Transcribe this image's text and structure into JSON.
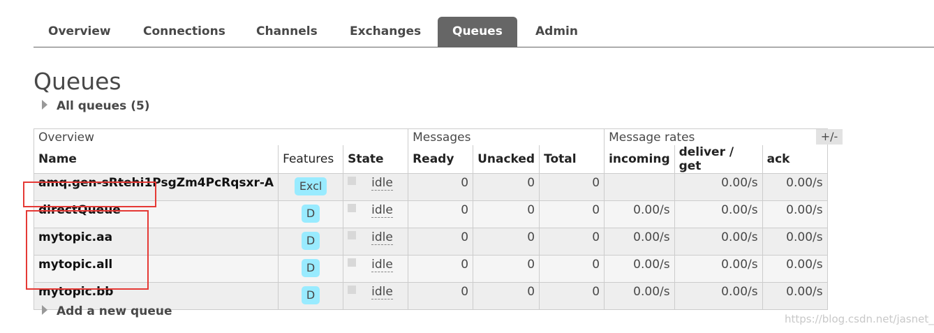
{
  "tabs": [
    {
      "label": "Overview"
    },
    {
      "label": "Connections"
    },
    {
      "label": "Channels"
    },
    {
      "label": "Exchanges"
    },
    {
      "label": "Queues",
      "active": true
    },
    {
      "label": "Admin"
    }
  ],
  "page_title": "Queues",
  "all_queues_label": "All queues (5)",
  "table": {
    "group_headers": [
      "Overview",
      "Messages",
      "Message rates"
    ],
    "columns": [
      "Name",
      "Features",
      "State",
      "Ready",
      "Unacked",
      "Total",
      "incoming",
      "deliver / get",
      "ack"
    ],
    "toggle_label": "+/-",
    "rows": [
      {
        "name": "amq.gen-sRtehi1PsgZm4PcRqsxr-A",
        "feature": "Excl",
        "state": "idle",
        "ready": "0",
        "unacked": "0",
        "total": "0",
        "incoming": "",
        "deliver_get": "0.00/s",
        "ack": "0.00/s"
      },
      {
        "name": "directQueue",
        "feature": "D",
        "state": "idle",
        "ready": "0",
        "unacked": "0",
        "total": "0",
        "incoming": "0.00/s",
        "deliver_get": "0.00/s",
        "ack": "0.00/s"
      },
      {
        "name": "mytopic.aa",
        "feature": "D",
        "state": "idle",
        "ready": "0",
        "unacked": "0",
        "total": "0",
        "incoming": "0.00/s",
        "deliver_get": "0.00/s",
        "ack": "0.00/s"
      },
      {
        "name": "mytopic.all",
        "feature": "D",
        "state": "idle",
        "ready": "0",
        "unacked": "0",
        "total": "0",
        "incoming": "0.00/s",
        "deliver_get": "0.00/s",
        "ack": "0.00/s"
      },
      {
        "name": "mytopic.bb",
        "feature": "D",
        "state": "idle",
        "ready": "0",
        "unacked": "0",
        "total": "0",
        "incoming": "0.00/s",
        "deliver_get": "0.00/s",
        "ack": "0.00/s"
      }
    ]
  },
  "add_queue_label": "Add a new queue",
  "watermark": "https://blog.csdn.net/jasnet_u",
  "colors": {
    "active_tab": "#666666",
    "badge": "#99ebff",
    "highlight": "#e53935"
  }
}
